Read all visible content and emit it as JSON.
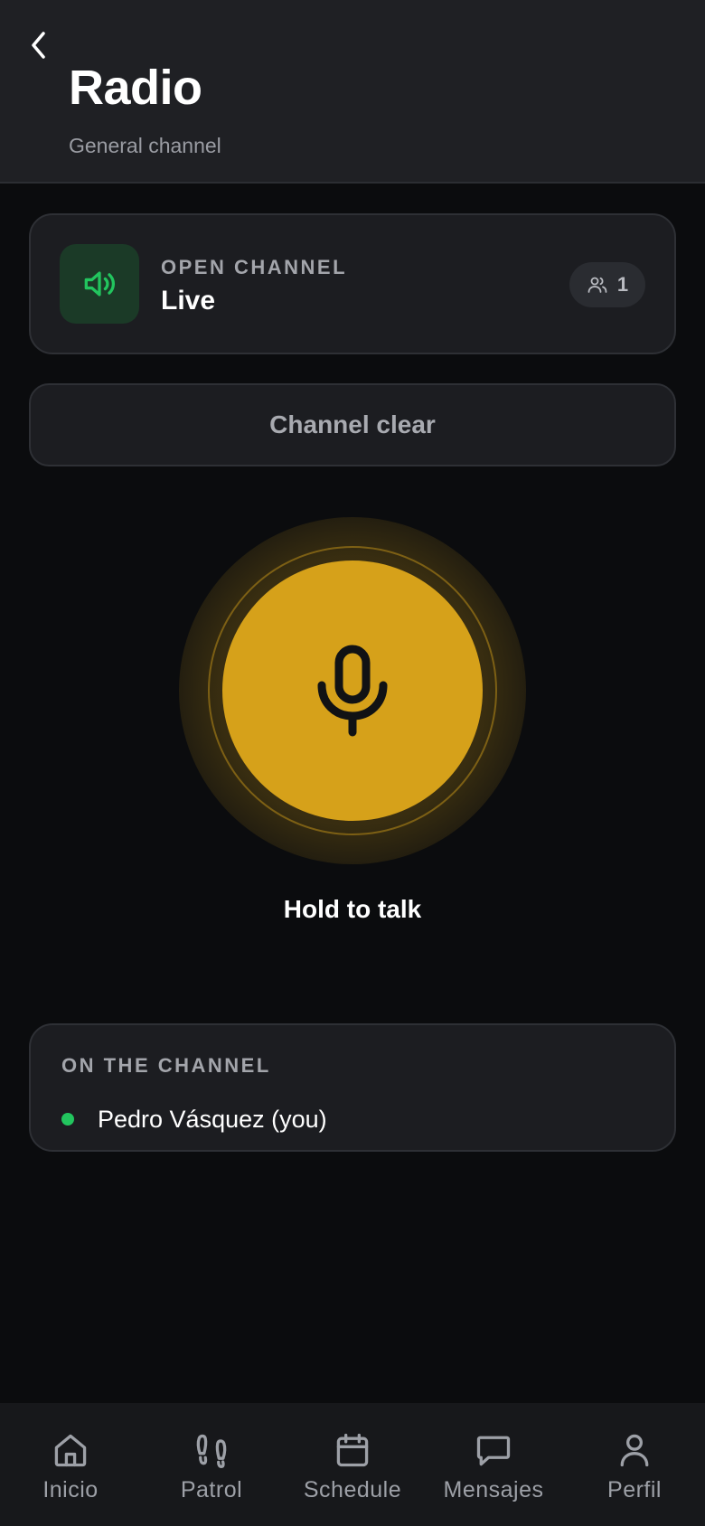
{
  "header": {
    "title": "Radio",
    "subtitle": "General channel",
    "back_icon": "chevron-left-icon"
  },
  "status": {
    "kicker": "OPEN CHANNEL",
    "value": "Live",
    "icon": "speaker-icon",
    "members_count": "1",
    "members_icon": "users-icon",
    "accent_color": "#22c55e"
  },
  "channel_state": {
    "label": "Channel clear"
  },
  "ptt": {
    "label": "Hold to talk",
    "icon": "microphone-icon",
    "color": "#d6a11a"
  },
  "members": {
    "title": "ON THE CHANNEL",
    "items": [
      {
        "name": "Pedro Vásquez (you)",
        "status_color": "#22c55e"
      }
    ]
  },
  "tabbar": {
    "items": [
      {
        "label": "Inicio",
        "icon": "home-icon"
      },
      {
        "label": "Patrol",
        "icon": "footprints-icon"
      },
      {
        "label": "Schedule",
        "icon": "calendar-icon"
      },
      {
        "label": "Mensajes",
        "icon": "message-icon"
      },
      {
        "label": "Perfil",
        "icon": "user-icon"
      }
    ]
  }
}
